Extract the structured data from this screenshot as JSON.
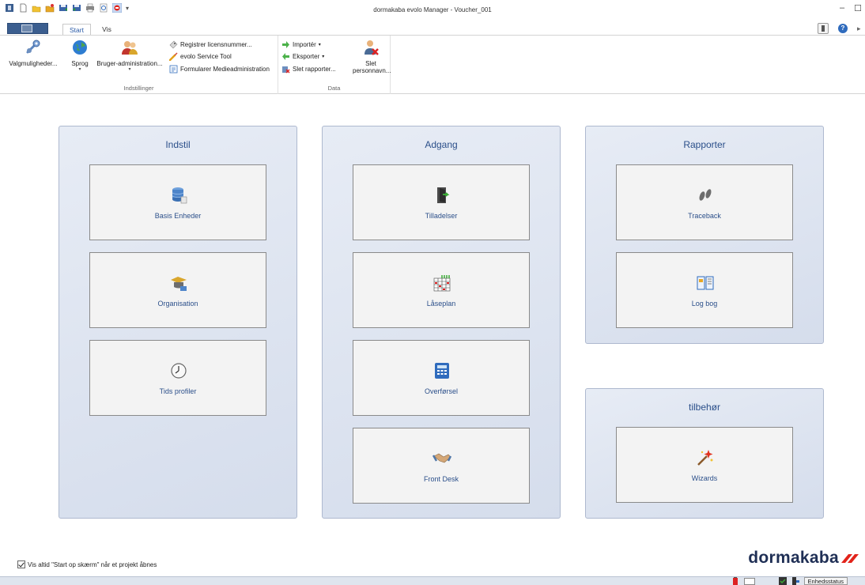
{
  "window": {
    "title": "dormakaba evolo Manager - Voucher_001"
  },
  "tabs": {
    "start": "Start",
    "vis": "Vis"
  },
  "ribbon": {
    "indstillinger": {
      "label": "Indstillinger",
      "valgmuligheder": "Valgmuligheder...",
      "sprog": "Sprog",
      "bruger": "Bruger-administration...",
      "registrer": "Registrer licensnummer...",
      "service_tool": "evolo Service Tool",
      "formularer": "Formularer Medieadministration"
    },
    "data": {
      "label": "Data",
      "importer": "Importér",
      "eksporter": "Eksporter",
      "slet_rapporter": "Slet rapporter...",
      "slet_personnavn_line1": "Slet",
      "slet_personnavn_line2": "personnavn..."
    }
  },
  "panels": {
    "indstil": {
      "title": "Indstil",
      "cards": [
        "Basis Enheder",
        "Organisation",
        "Tids profiler"
      ]
    },
    "adgang": {
      "title": "Adgang",
      "cards": [
        "Tilladelser",
        "Låseplan",
        "Overførsel",
        "Front Desk"
      ]
    },
    "rapporter": {
      "title": "Rapporter",
      "cards": [
        "Traceback",
        "Log bog"
      ]
    },
    "tilbehor": {
      "title": "tilbehør",
      "cards": [
        "Wizards"
      ]
    }
  },
  "footer": {
    "checkbox_label": "Vis altid \"Start op skærm\" når et projekt åbnes",
    "brand": "dormakaba"
  },
  "statusbar": {
    "enhedsstatus": "Enhedsstatus"
  },
  "colors": {
    "panel_title": "#2b4f8a",
    "brand_red": "#e2231a",
    "brand_navy": "#1f2f55"
  }
}
